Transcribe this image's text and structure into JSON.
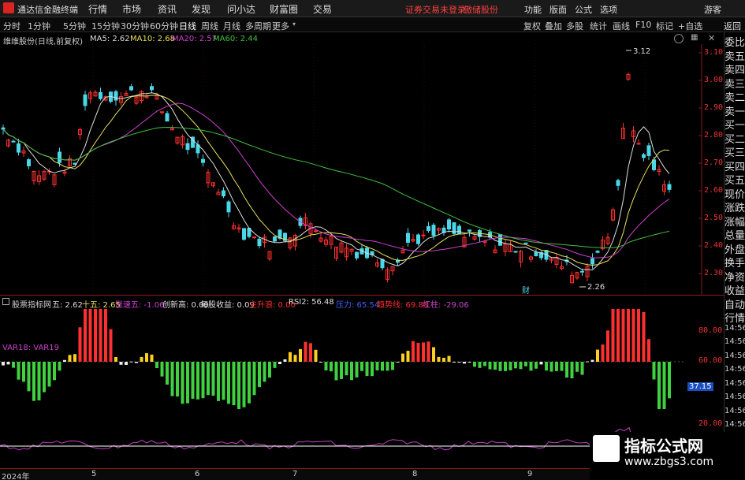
{
  "app": {
    "title": "通达信金融终端",
    "menu": [
      "行情",
      "市场",
      "资讯",
      "发现",
      "问小达",
      "财富圈",
      "交易"
    ],
    "login_notice": "证券交易未登录",
    "login_notice2": "傲储股份",
    "right_menu": [
      "功能",
      "版面",
      "公式",
      "选项"
    ],
    "user": "游客"
  },
  "toolbar": {
    "periods": [
      "分时",
      "1分钟",
      "5分钟",
      "15分钟",
      "30分钟",
      "60分钟",
      "日线",
      "周线",
      "月线",
      "多周期",
      "更多"
    ],
    "active_period": "日线",
    "right_items": [
      "复权",
      "叠加",
      "多股",
      "统计",
      "画线",
      "F10",
      "标记",
      "+自选"
    ],
    "side_tab": "返回"
  },
  "stock": {
    "legend_title": "维维股份(日线,前复权)",
    "ma_labels": [
      {
        "text": "MA5: 2.62",
        "color": "#dddddd"
      },
      {
        "text": "MA10: 2.68",
        "color": "#e8e05a"
      },
      {
        "text": "MA20: 2.57",
        "color": "#d040d0"
      },
      {
        "text": "MA60: 2.44",
        "color": "#40c040"
      }
    ],
    "price_ticks": [
      "3.10",
      "3.00",
      "2.90",
      "2.80",
      "2.70",
      "2.60",
      "2.50",
      "2.40",
      "2.30"
    ],
    "high_label": "3.12",
    "low_label": "2.26",
    "markers": [
      "财"
    ]
  },
  "indicator": {
    "name": "股票指标网",
    "values": [
      {
        "text": "五: 2.62",
        "color": "#dddddd"
      },
      {
        "text": "十五: 2.65",
        "color": "#e8e05a"
      },
      {
        "text": "涨速五: -1.06",
        "color": "#d040d0"
      },
      {
        "text": "创新高: 0.00",
        "color": "#dddddd"
      },
      {
        "text": "每股收益: 0.09",
        "color": "#dddddd"
      },
      {
        "text": "主升浪: 0.00",
        "color": "#ff3030"
      },
      {
        "text": "RSI2: 56.48",
        "color": "#dddddd"
      },
      {
        "text": "压力: 65.54",
        "color": "#4060ff"
      },
      {
        "text": "趋势线: 69.83",
        "color": "#ff3030"
      },
      {
        "text": "红柱: -29.06",
        "color": "#d040d0"
      }
    ],
    "var_label": "VAR18: VAR19",
    "axis_ticks": [
      "80.00",
      "60.00",
      "20.00"
    ],
    "current_value": "37.15"
  },
  "side_panel": {
    "labels": [
      "委比",
      "卖五",
      "卖四",
      "卖三",
      "卖二",
      "卖一",
      "买一",
      "买二",
      "买三",
      "买四",
      "买五",
      "现价",
      "涨跌",
      "涨幅",
      "总量",
      "外盘",
      "换手",
      "净资",
      "收益",
      "自动",
      "行情",
      "14:56",
      "14:56",
      "14:56",
      "14:56",
      "14:56",
      "14:56",
      "14:56",
      "14:56",
      "14:56",
      "14:56",
      "14:56"
    ]
  },
  "time_axis": [
    "2024年",
    "5",
    "6",
    "7",
    "8",
    "9"
  ],
  "watermark": {
    "line1": "指标公式网",
    "line2": "www.zbgs3.com"
  },
  "colors": {
    "up": "#ff3030",
    "down": "#4ad8e8",
    "grid": "#5a1010",
    "axis": "#8a1a1a"
  }
}
